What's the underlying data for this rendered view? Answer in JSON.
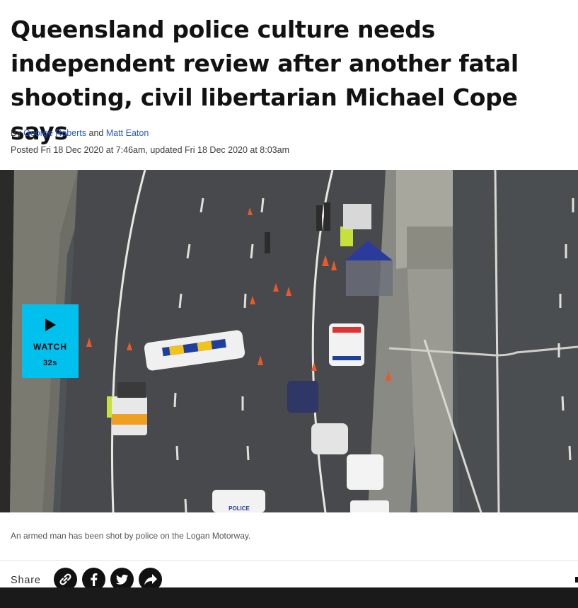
{
  "article": {
    "headline": "Queensland police culture needs independent review after another fatal shooting, civil libertarian Michael Cope says",
    "byline_prefix": "By",
    "author1": "George Roberts",
    "byline_and": "and",
    "author2": "Matt Eaton",
    "dateline": "Posted Fri 18 Dec 2020 at 7:46am, updated Fri 18 Dec 2020 at 8:03am"
  },
  "hero": {
    "watch_label": "WATCH",
    "duration": "32s",
    "caption": "An armed man has been shot by police on the Logan Motorway.",
    "scene_police_text": "POLICE"
  },
  "share": {
    "label": "Share",
    "icons": [
      "link-icon",
      "facebook-icon",
      "twitter-icon",
      "share-arrow-icon"
    ]
  },
  "colors": {
    "link": "#2b59c3",
    "watch_bg": "#00c1ee",
    "headline": "#121212"
  }
}
